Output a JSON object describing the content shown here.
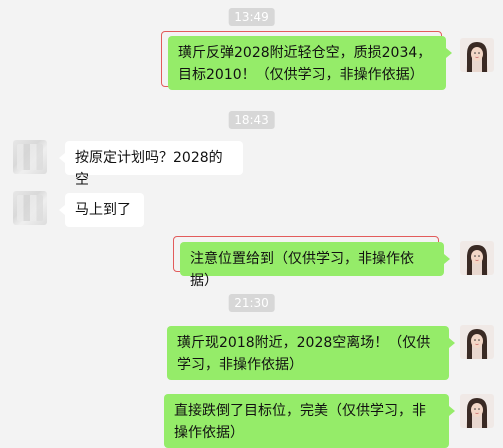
{
  "timestamps": {
    "t1": "13:49",
    "t2": "18:43",
    "t3": "21:30"
  },
  "messages": {
    "m1": "璜斤反弹2028附近轻仓空，质损2034，目标2010！（仅供学习，非操作依据）",
    "m2": "按原定计划吗？2028的空",
    "m3": "马上到了",
    "m4": "注意位置给到（仅供学习，非操作依据）",
    "m5": "璜斤现2018附近，2028空离场！（仅供学习，非操作依据）",
    "m6": "直接跌倒了目标位，完美（仅供学习，非操作依据）"
  },
  "colors": {
    "background": "#f3f3f3",
    "self_bubble": "#95ec69",
    "other_bubble": "#ffffff",
    "timestamp_bg": "#d7d7d7",
    "highlight": "#e25b5b"
  }
}
